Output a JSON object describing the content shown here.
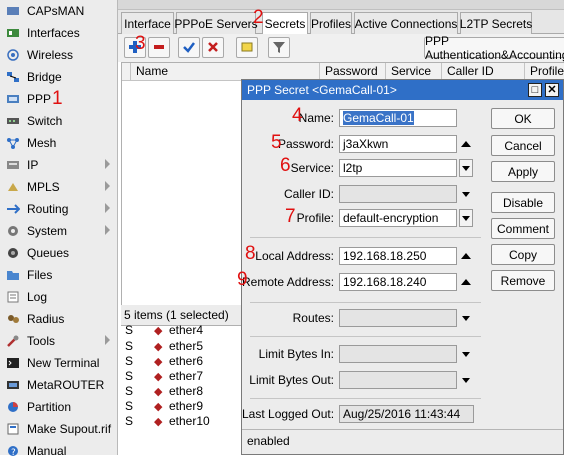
{
  "sidebar": {
    "items": [
      {
        "label": "CAPsMAN",
        "icon": "capsman-icon",
        "submenu": false
      },
      {
        "label": "Interfaces",
        "icon": "interfaces-icon",
        "submenu": false
      },
      {
        "label": "Wireless",
        "icon": "wireless-icon",
        "submenu": false
      },
      {
        "label": "Bridge",
        "icon": "bridge-icon",
        "submenu": false
      },
      {
        "label": "PPP",
        "icon": "ppp-icon",
        "submenu": false
      },
      {
        "label": "Switch",
        "icon": "switch-icon",
        "submenu": false
      },
      {
        "label": "Mesh",
        "icon": "mesh-icon",
        "submenu": false
      },
      {
        "label": "IP",
        "icon": "ip-icon",
        "submenu": true
      },
      {
        "label": "MPLS",
        "icon": "mpls-icon",
        "submenu": true
      },
      {
        "label": "Routing",
        "icon": "routing-icon",
        "submenu": true
      },
      {
        "label": "System",
        "icon": "system-icon",
        "submenu": true
      },
      {
        "label": "Queues",
        "icon": "queues-icon",
        "submenu": false
      },
      {
        "label": "Files",
        "icon": "files-icon",
        "submenu": false
      },
      {
        "label": "Log",
        "icon": "log-icon",
        "submenu": false
      },
      {
        "label": "Radius",
        "icon": "radius-icon",
        "submenu": false
      },
      {
        "label": "Tools",
        "icon": "tools-icon",
        "submenu": true
      },
      {
        "label": "New Terminal",
        "icon": "terminal-icon",
        "submenu": false
      },
      {
        "label": "MetaROUTER",
        "icon": "metarouter-icon",
        "submenu": false
      },
      {
        "label": "Partition",
        "icon": "partition-icon",
        "submenu": false
      },
      {
        "label": "Make Supout.rif",
        "icon": "supout-icon",
        "submenu": false
      },
      {
        "label": "Manual",
        "icon": "manual-icon",
        "submenu": false
      }
    ]
  },
  "annotations": {
    "n1": "1",
    "n2": "2",
    "n3": "3",
    "n4": "4",
    "n5": "5",
    "n6": "6",
    "n7": "7",
    "n8": "8",
    "n9": "9"
  },
  "tabs": [
    {
      "label": "Interface",
      "active": false
    },
    {
      "label": "PPPoE Servers",
      "active": false
    },
    {
      "label": "Secrets",
      "active": true
    },
    {
      "label": "Profiles",
      "active": false
    },
    {
      "label": "Active Connections",
      "active": false
    },
    {
      "label": "L2TP Secrets",
      "active": false
    }
  ],
  "toolbar": {
    "add_icon": "plus-icon",
    "remove_icon": "minus-icon",
    "enable_icon": "check-icon",
    "disable_icon": "x-icon",
    "comment_icon": "comment-icon",
    "filter_icon": "filter-icon",
    "ppp_auth_label": "PPP Authentication&Accounting"
  },
  "list": {
    "columns": [
      "Name",
      "Password",
      "Service",
      "Caller ID",
      "Profile"
    ],
    "status": "5 items (1 selected)"
  },
  "interfaces": [
    {
      "flag": "S",
      "name": "ether4"
    },
    {
      "flag": "S",
      "name": "ether5"
    },
    {
      "flag": "S",
      "name": "ether6"
    },
    {
      "flag": "S",
      "name": "ether7"
    },
    {
      "flag": "S",
      "name": "ether8"
    },
    {
      "flag": "S",
      "name": "ether9"
    },
    {
      "flag": "S",
      "name": "ether10"
    }
  ],
  "dialog": {
    "title": "PPP Secret <GemaCall-01>",
    "fields": {
      "name": {
        "label": "Name:",
        "value": "GemaCall-01"
      },
      "password": {
        "label": "Password:",
        "value": "j3aXkwn"
      },
      "service": {
        "label": "Service:",
        "value": "l2tp"
      },
      "caller_id": {
        "label": "Caller ID:",
        "value": ""
      },
      "profile": {
        "label": "Profile:",
        "value": "default-encryption"
      },
      "local_address": {
        "label": "Local Address:",
        "value": "192.168.18.250"
      },
      "remote_address": {
        "label": "Remote Address:",
        "value": "192.168.18.240"
      },
      "routes": {
        "label": "Routes:",
        "value": ""
      },
      "limit_in": {
        "label": "Limit Bytes In:",
        "value": ""
      },
      "limit_out": {
        "label": "Limit Bytes Out:",
        "value": ""
      },
      "last_logged_out": {
        "label": "Last Logged Out:",
        "value": "Aug/25/2016 11:43:44"
      }
    },
    "buttons": {
      "ok": "OK",
      "cancel": "Cancel",
      "apply": "Apply",
      "disable": "Disable",
      "comment": "Comment",
      "copy": "Copy",
      "remove": "Remove"
    },
    "status": "enabled"
  },
  "colors": {
    "accent_blue": "#2f6fc7",
    "annotation_red": "#e01010",
    "selection": "#3a73c7"
  }
}
